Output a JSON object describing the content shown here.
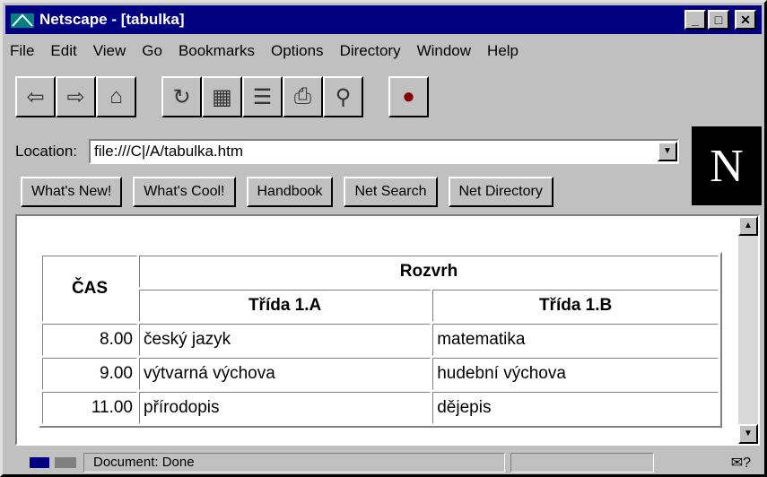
{
  "window": {
    "title": "Netscape - [tabulka]"
  },
  "menu": [
    "File",
    "Edit",
    "View",
    "Go",
    "Bookmarks",
    "Options",
    "Directory",
    "Window",
    "Help"
  ],
  "toolbar": {
    "icons": [
      "back-icon",
      "forward-icon",
      "home-icon",
      "reload-icon",
      "images-icon",
      "open-icon",
      "print-icon",
      "find-icon",
      "stop-icon"
    ]
  },
  "location": {
    "label": "Location:",
    "value": "file:///C|/A/tabulka.htm"
  },
  "directory_buttons": [
    "What's New!",
    "What's Cool!",
    "Handbook",
    "Net Search",
    "Net Directory"
  ],
  "logo": {
    "letter": "N"
  },
  "table": {
    "time_header": "ČAS",
    "group_header": "Rozvrh",
    "class_a": "Třída 1.A",
    "class_b": "Třída 1.B",
    "rows": [
      {
        "time": "8.00",
        "a": "český jazyk",
        "b": "matematika"
      },
      {
        "time": "9.00",
        "a": "výtvarná výchova",
        "b": "hudební výchova"
      },
      {
        "time": "11.00",
        "a": "přírodopis",
        "b": "dějepis"
      }
    ]
  },
  "status": {
    "text": "Document: Done"
  }
}
